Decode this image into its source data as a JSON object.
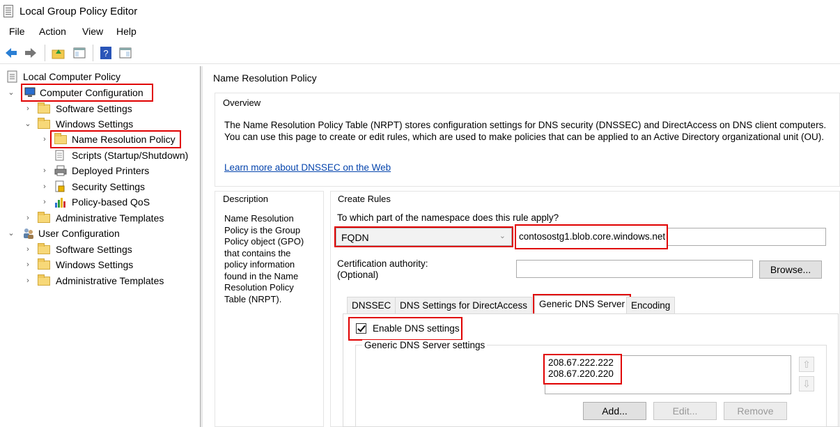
{
  "window": {
    "title": "Local Group Policy Editor"
  },
  "menu": [
    "File",
    "Action",
    "View",
    "Help"
  ],
  "toolbar": {
    "icons": [
      "back-arrow-icon",
      "forward-arrow-icon",
      "up-folder-icon",
      "show-hide-tree-icon",
      "help-icon",
      "properties-icon"
    ]
  },
  "tree": {
    "items": [
      {
        "label": "Local Computer Policy"
      },
      {
        "label": "Computer Configuration"
      },
      {
        "label": "Software Settings"
      },
      {
        "label": "Windows Settings"
      },
      {
        "label": "Name Resolution Policy"
      },
      {
        "label": "Scripts (Startup/Shutdown)"
      },
      {
        "label": "Deployed Printers"
      },
      {
        "label": "Security Settings"
      },
      {
        "label": "Policy-based QoS"
      },
      {
        "label": "Administrative Templates"
      },
      {
        "label": "User Configuration"
      },
      {
        "label": "Software Settings"
      },
      {
        "label": "Windows Settings"
      },
      {
        "label": "Administrative Templates"
      }
    ]
  },
  "main": {
    "title": "Name Resolution Policy",
    "overview": {
      "label": "Overview",
      "line1": "The Name Resolution Policy Table (NRPT) stores configuration settings for DNS security (DNSSEC) and DirectAccess on DNS client computers.",
      "line2": "You can use this page to create or edit rules, which are used to make policies that can be applied to an Active Directory organizational unit (OU).",
      "link": "Learn more about DNSSEC on the Web"
    },
    "description": {
      "label": "Description",
      "text": "Name Resolution Policy is the Group Policy object (GPO) that contains the policy information found in the Name Resolution Policy Table (NRPT)."
    },
    "create_rules": {
      "label": "Create Rules",
      "question": "To which part of the namespace does this rule apply?",
      "namespace_type": "FQDN",
      "namespace_value": "contosostg1.blob.core.windows.net",
      "cert_label_1": "Certification authority:",
      "cert_label_2": "(Optional)",
      "cert_value": "",
      "browse_label": "Browse...",
      "tabs": [
        "DNSSEC",
        "DNS Settings for DirectAccess",
        "Generic DNS Server",
        "Encoding"
      ],
      "active_tab": "Generic DNS Server",
      "enable_label": "Enable DNS settings",
      "enable_checked": true,
      "group_label": "Generic DNS Server settings",
      "servers": [
        "208.67.222.222",
        "208.67.220.220"
      ],
      "add_label": "Add...",
      "edit_label": "Edit...",
      "remove_label": "Remove"
    }
  },
  "colors": {
    "highlight": "#e00000",
    "link": "#0645ad"
  }
}
